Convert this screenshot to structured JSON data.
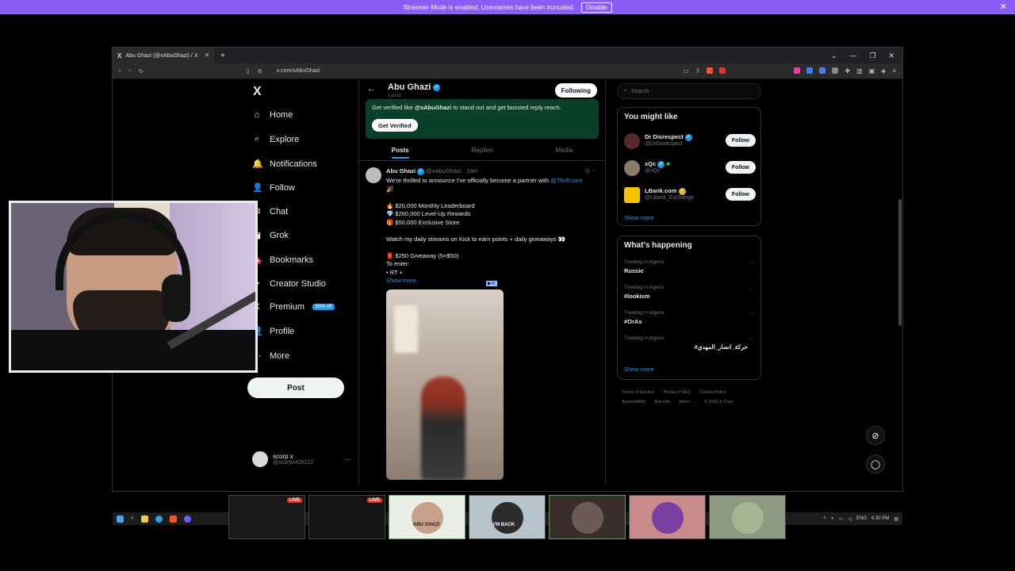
{
  "banner": {
    "text": "Streamer Mode is enabled. Usernames have been truncated.",
    "disable_label": "Disable",
    "close": "✕"
  },
  "browser": {
    "tab_title": "Abu Ghazi (@xAbuGhazi) / X",
    "tab_icon": "X",
    "url": "x.com/xAbuGhazi",
    "new_tab": "+"
  },
  "x_logo": "X",
  "nav": [
    {
      "label": "Home",
      "icon": "⌂"
    },
    {
      "label": "Explore",
      "icon": "⌕"
    },
    {
      "label": "Notifications",
      "icon": "🔔"
    },
    {
      "label": "Follow",
      "icon": "👤"
    },
    {
      "label": "Chat",
      "icon": "✉"
    },
    {
      "label": "Grok",
      "icon": "◪"
    },
    {
      "label": "Bookmarks",
      "icon": "🔖"
    },
    {
      "label": "Creator Studio",
      "icon": "✦"
    },
    {
      "label": "Premium",
      "icon": "X"
    },
    {
      "label": "Profile",
      "icon": "👤"
    },
    {
      "label": "More",
      "icon": "⋯"
    }
  ],
  "premium_badge": "50% off",
  "post_button": "Post",
  "account": {
    "name": "scorp x",
    "handle": "@scorpx428122",
    "dots": "···"
  },
  "profile": {
    "name": "Abu Ghazi",
    "posts": "1 post",
    "following_label": "Following",
    "promo_prefix": "Get verified like ",
    "promo_handle": "@xAbuGhazi",
    "promo_suffix": " to stand out and get boosted reply reach.",
    "get_verified": "Get Verified"
  },
  "tabs": [
    "Posts",
    "Replies",
    "Media"
  ],
  "tweet": {
    "name": "Abu Ghazi",
    "handle": "@xAbuGhazi",
    "time": "· 18m",
    "line1_prefix": "We're thrilled to announce I've officially become a partner with ",
    "line1_mention": "@Thrill.com",
    "line1_emoji": "🎉",
    "rewards": [
      "🔥 $20,000 Monthly Leaderboard",
      "💎 $260,000 Level-Up Rewards",
      "🎁 $50,000 Exclusive Store"
    ],
    "streams": "Watch my daily streams on Kick to earn points + daily giveaways 👀",
    "giveaway": "🧧 $250 Giveaway (5×$50)",
    "to_enter": "To enter:",
    "rt": "• RT +",
    "show_more": "Show more",
    "ad_tag": "▶✕"
  },
  "right": {
    "search_placeholder": "Search",
    "you_might_like": "You might like",
    "suggestions": [
      {
        "name": "Dr Disrespect",
        "handle": "@DrDisrespect",
        "follow": "Follow",
        "color": "#5a2a2a",
        "badge": "blue"
      },
      {
        "name": "xQc",
        "handle": "@xQc",
        "follow": "Follow",
        "color": "#8a7a6a",
        "badge": "blue"
      },
      {
        "name": "LBank.com",
        "handle": "@LBank_Exchange",
        "follow": "Follow",
        "color": "#f5c400",
        "badge": "gold"
      }
    ],
    "show_more": "Show more",
    "whats_happening": "What's happening",
    "trends": [
      {
        "context": "Trending in Algeria",
        "title": "Russie"
      },
      {
        "context": "Trending in Algeria",
        "title": "#lookism"
      },
      {
        "context": "Trending in Algeria",
        "title": "#OrAs"
      },
      {
        "context": "Trending in Algeria",
        "title": "#حركة_انصار_المهدي"
      }
    ],
    "trends_more": "Show more",
    "footer": [
      "Terms of Service",
      "Privacy Policy",
      "Cookie Policy",
      "Accessibility",
      "Ads info",
      "More ···",
      "© 2026 X Corp."
    ]
  },
  "taskbar": {
    "lang": "ENG",
    "time": "6:30 PM"
  },
  "thumbnails": [
    {
      "live": "LIVE",
      "bg": "#1a1a1a"
    },
    {
      "live": "LIVE",
      "bg": "#141414"
    },
    {
      "label": "ABU GHAZI",
      "bg": "#e9eee6"
    },
    {
      "label": "I'M BACK",
      "bg": "#b7c4cc"
    },
    {
      "label": "",
      "bg": "#3a2e2c"
    },
    {
      "label": "",
      "bg": "#c98a8a"
    },
    {
      "label": "",
      "bg": "#8e9a82"
    }
  ]
}
